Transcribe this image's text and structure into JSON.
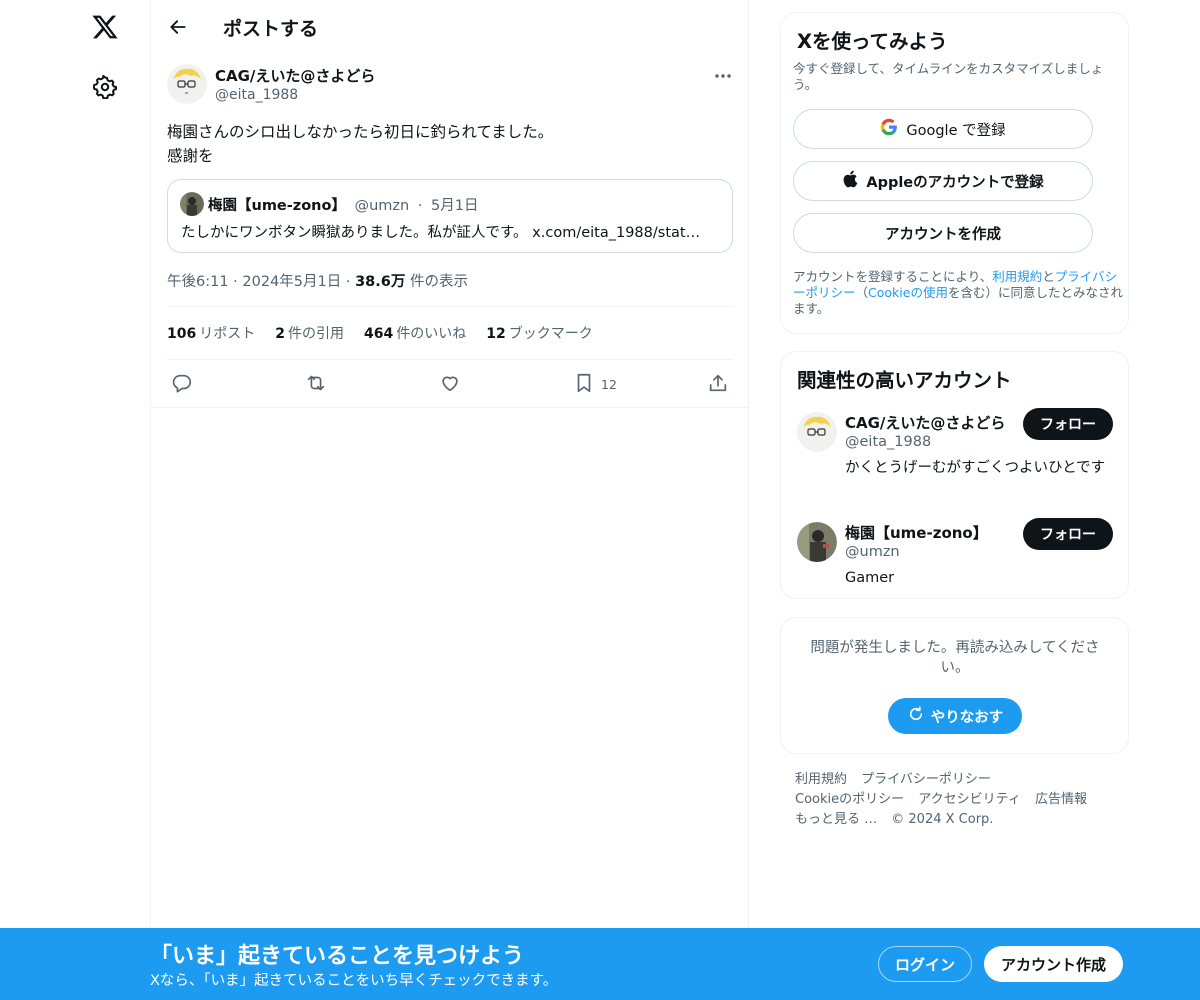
{
  "header": {
    "title": "ポストする"
  },
  "post": {
    "author_name": "CAG/えいた@さよどら",
    "author_handle": "@eita_1988",
    "text_line1": "梅園さんのシロ出しなかったら初日に釣られてました。",
    "text_line2": "感謝を",
    "quote": {
      "name": "梅園【ume-zono】",
      "handle": "@umzn",
      "sep": "·",
      "date": "5月1日",
      "text": "たしかにワンボタン瞬獄ありました。私が証人です。",
      "link": "x.com/eita_1988/stat…"
    },
    "time": "午後6:11",
    "dot": "·",
    "date": "2024年5月1日",
    "views_count": "38.6万",
    "views_label": "件の表示",
    "stats": {
      "reposts_count": "106",
      "reposts_label": "リポスト",
      "quotes_count": "2",
      "quotes_label": "件の引用",
      "likes_count": "464",
      "likes_label": "件のいいね",
      "bookmarks_count": "12",
      "bookmarks_label": "ブックマーク"
    },
    "actions": {
      "bookmark_count": "12"
    }
  },
  "signup": {
    "title": "Xを使ってみよう",
    "subtitle": "今すぐ登録して、タイムラインをカスタマイズしましょう。",
    "google_label": "Google で登録",
    "apple_label": "Appleのアカウントで登録",
    "create_label": "アカウントを作成",
    "terms_pre": "アカウントを登録することにより、",
    "terms_link1": "利用規約",
    "terms_and": "と",
    "terms_link2": "プライバシーポリシー",
    "terms_paren_open": "（",
    "terms_link3": "Cookieの使用",
    "terms_post": "を含む）に同意したとみなされます。"
  },
  "related": {
    "title": "関連性の高いアカウント",
    "accounts": [
      {
        "name": "CAG/えいた@さよどら",
        "handle": "@eita_1988",
        "bio": "かくとうげーむがすごくつよいひとです",
        "follow": "フォロー"
      },
      {
        "name": "梅園【ume-zono】",
        "handle": "@umzn",
        "bio": "Gamer",
        "follow": "フォロー"
      }
    ]
  },
  "error": {
    "text": "問題が発生しました。再読み込みしてください。",
    "retry": "やりなおす"
  },
  "footer": {
    "tos": "利用規約",
    "privacy": "プライバシーポリシー",
    "cookie": "Cookieのポリシー",
    "accessibility": "アクセシビリティ",
    "ads": "広告情報",
    "more": "もっと見る …",
    "copyright": "© 2024 X Corp."
  },
  "banner": {
    "title": "「いま」起きていることを見つけよう",
    "subtitle": "Xなら、「いま」起きていることをいち早くチェックできます。",
    "login": "ログイン",
    "create": "アカウント作成"
  },
  "colors": {
    "accent": "#1d9bf0",
    "text": "#0f1419",
    "muted": "#536471",
    "border": "#eff3f4"
  },
  "icons": [
    "x-logo-icon",
    "gear-icon",
    "back-arrow-icon",
    "more-icon",
    "reply-icon",
    "repost-icon",
    "like-icon",
    "bookmark-icon",
    "share-icon",
    "google-icon",
    "apple-icon",
    "refresh-icon"
  ]
}
